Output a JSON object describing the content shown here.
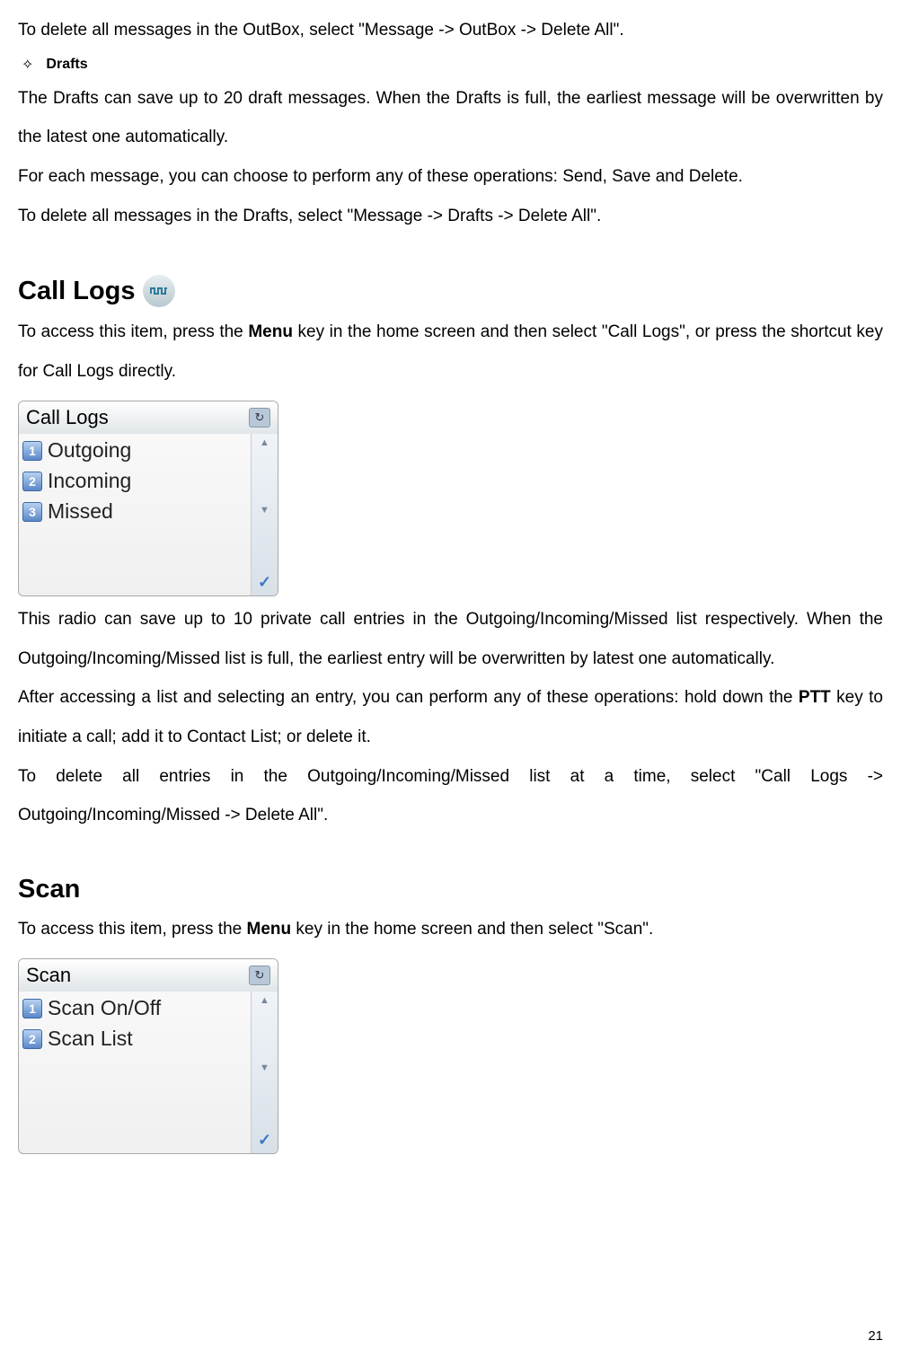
{
  "p1": "To delete all messages in the OutBox, select \"Message -> OutBox -> Delete All\".",
  "drafts": {
    "bullet": "✧",
    "label": "Drafts",
    "p1": "The Drafts can save up to 20 draft messages. When the Drafts is full, the earliest message will be overwritten by the latest one automatically.",
    "p2": "For each message, you can choose to perform any of these operations: Send, Save and Delete.",
    "p3": "To delete all messages in the Drafts, select \"Message -> Drafts -> Delete All\"."
  },
  "calllogs": {
    "heading": "Call Logs",
    "intro_before": "To access this item, press the ",
    "menu_key": "Menu",
    "intro_after": " key in the home screen and then select \"Call Logs\", or press the shortcut key for Call Logs directly.",
    "screen_title": "Call Logs",
    "items": [
      "Outgoing",
      "Incoming",
      "Missed"
    ],
    "nums": [
      "1",
      "2",
      "3"
    ],
    "refresh": "↻",
    "p_after1": "This radio can save up to 10 private call entries in the Outgoing/Incoming/Missed list respectively. When the Outgoing/Incoming/Missed list is full, the earliest entry will be overwritten by latest one automatically.",
    "p_after2_before": "After accessing a list and selecting an entry, you can perform any of these operations: hold down the ",
    "ptt_key": "PTT",
    "p_after2_after": " key to initiate a call; add it to Contact List; or delete it.",
    "p_after3": "To delete all entries in the Outgoing/Incoming/Missed list at a time, select \"Call Logs -> Outgoing/Incoming/Missed -> Delete All\"."
  },
  "scan": {
    "heading": "Scan",
    "intro_before": "To access this item, press the ",
    "menu_key": "Menu",
    "intro_after": " key in the home screen and then select \"Scan\".",
    "screen_title": "Scan",
    "items": [
      "Scan On/Off",
      "Scan List"
    ],
    "nums": [
      "1",
      "2"
    ],
    "refresh": "↻"
  },
  "page_number": "21"
}
